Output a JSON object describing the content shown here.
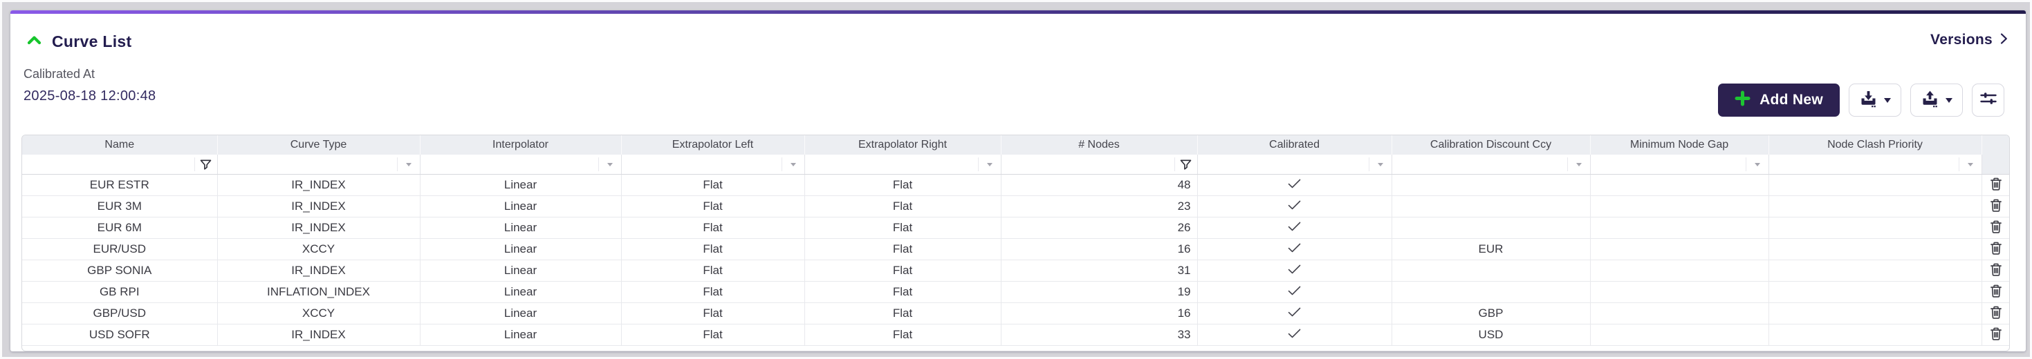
{
  "header": {
    "title": "Curve List",
    "versions_label": "Versions",
    "calibrated_at_label": "Calibrated At",
    "calibrated_at_value": "2025-08-18 12:00:48"
  },
  "toolbar": {
    "add_new_label": "Add New",
    "icons": [
      "plus-icon",
      "download-icon",
      "upload-icon",
      "sliders-icon",
      "caret-down-icon"
    ]
  },
  "colors": {
    "accent_green": "#16c52c",
    "primary_navy": "#2c2150",
    "gradient_left": "#8a5ae8",
    "gradient_right": "#241d4e",
    "header_row_bg": "#eceef2",
    "page_bg": "#d5d4d9"
  },
  "table": {
    "columns": [
      {
        "key": "name",
        "label": "Name",
        "filter": "funnel"
      },
      {
        "key": "curve_type",
        "label": "Curve Type",
        "filter": "dropdown"
      },
      {
        "key": "interpolator",
        "label": "Interpolator",
        "filter": "dropdown"
      },
      {
        "key": "extrapolator_left",
        "label": "Extrapolator Left",
        "filter": "dropdown"
      },
      {
        "key": "extrapolator_right",
        "label": "Extrapolator Right",
        "filter": "dropdown"
      },
      {
        "key": "nodes",
        "label": "# Nodes",
        "filter": "funnel",
        "align": "right"
      },
      {
        "key": "calibrated",
        "label": "Calibrated",
        "filter": "dropdown",
        "type": "check"
      },
      {
        "key": "calibration_discount_ccy",
        "label": "Calibration Discount Ccy",
        "filter": "dropdown"
      },
      {
        "key": "minimum_node_gap",
        "label": "Minimum Node Gap",
        "filter": "dropdown"
      },
      {
        "key": "node_clash_priority",
        "label": "Node Clash Priority",
        "filter": "dropdown"
      },
      {
        "key": "actions",
        "label": "",
        "filter": "none",
        "type": "actions"
      }
    ],
    "rows": [
      {
        "name": "EUR ESTR",
        "curve_type": "IR_INDEX",
        "interpolator": "Linear",
        "extrapolator_left": "Flat",
        "extrapolator_right": "Flat",
        "nodes": 48,
        "calibrated": true,
        "calibration_discount_ccy": "",
        "minimum_node_gap": "",
        "node_clash_priority": ""
      },
      {
        "name": "EUR 3M",
        "curve_type": "IR_INDEX",
        "interpolator": "Linear",
        "extrapolator_left": "Flat",
        "extrapolator_right": "Flat",
        "nodes": 23,
        "calibrated": true,
        "calibration_discount_ccy": "",
        "minimum_node_gap": "",
        "node_clash_priority": ""
      },
      {
        "name": "EUR 6M",
        "curve_type": "IR_INDEX",
        "interpolator": "Linear",
        "extrapolator_left": "Flat",
        "extrapolator_right": "Flat",
        "nodes": 26,
        "calibrated": true,
        "calibration_discount_ccy": "",
        "minimum_node_gap": "",
        "node_clash_priority": ""
      },
      {
        "name": "EUR/USD",
        "curve_type": "XCCY",
        "interpolator": "Linear",
        "extrapolator_left": "Flat",
        "extrapolator_right": "Flat",
        "nodes": 16,
        "calibrated": true,
        "calibration_discount_ccy": "EUR",
        "minimum_node_gap": "",
        "node_clash_priority": ""
      },
      {
        "name": "GBP SONIA",
        "curve_type": "IR_INDEX",
        "interpolator": "Linear",
        "extrapolator_left": "Flat",
        "extrapolator_right": "Flat",
        "nodes": 31,
        "calibrated": true,
        "calibration_discount_ccy": "",
        "minimum_node_gap": "",
        "node_clash_priority": ""
      },
      {
        "name": "GB RPI",
        "curve_type": "INFLATION_INDEX",
        "interpolator": "Linear",
        "extrapolator_left": "Flat",
        "extrapolator_right": "Flat",
        "nodes": 19,
        "calibrated": true,
        "calibration_discount_ccy": "",
        "minimum_node_gap": "",
        "node_clash_priority": ""
      },
      {
        "name": "GBP/USD",
        "curve_type": "XCCY",
        "interpolator": "Linear",
        "extrapolator_left": "Flat",
        "extrapolator_right": "Flat",
        "nodes": 16,
        "calibrated": true,
        "calibration_discount_ccy": "GBP",
        "minimum_node_gap": "",
        "node_clash_priority": ""
      },
      {
        "name": "USD SOFR",
        "curve_type": "IR_INDEX",
        "interpolator": "Linear",
        "extrapolator_left": "Flat",
        "extrapolator_right": "Flat",
        "nodes": 33,
        "calibrated": true,
        "calibration_discount_ccy": "USD",
        "minimum_node_gap": "",
        "node_clash_priority": ""
      }
    ]
  }
}
